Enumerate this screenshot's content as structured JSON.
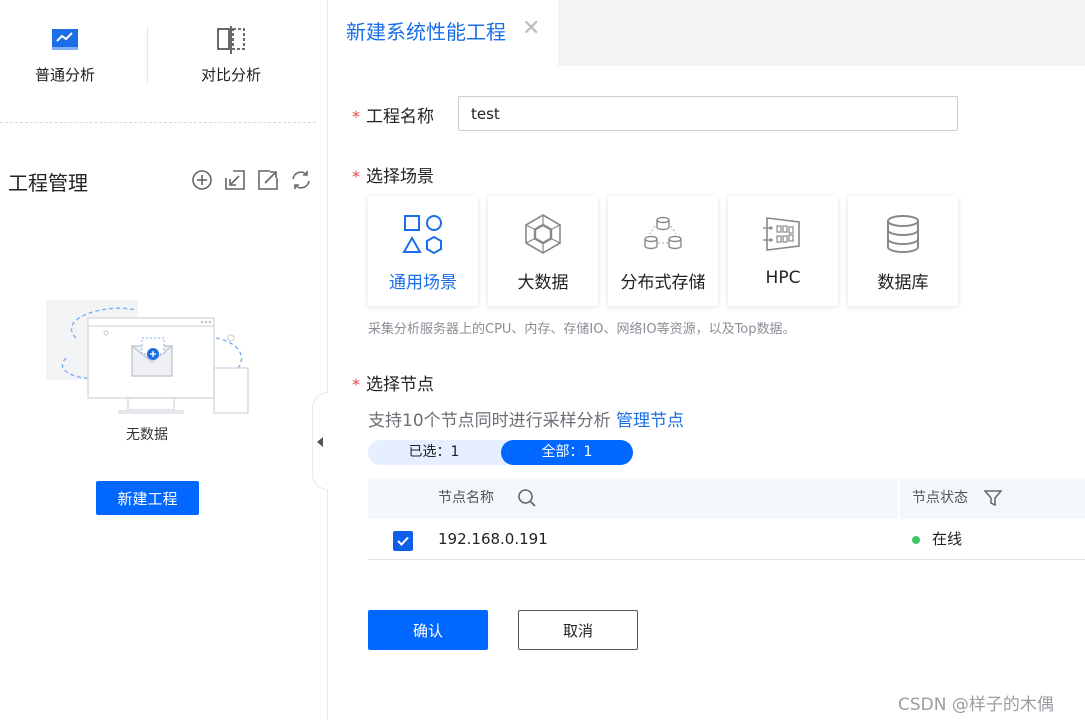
{
  "colors": {
    "accent": "#0067ff",
    "link": "#1a6fe8",
    "online": "#3fc564",
    "required": "#e5483e"
  },
  "sidebar": {
    "modes": [
      {
        "label": "普通分析",
        "icon": "monitor-chart-icon",
        "active": true
      },
      {
        "label": "对比分析",
        "icon": "compare-split-icon",
        "active": false
      }
    ],
    "project_title": "工程管理",
    "tools": [
      "add-circle-icon",
      "import-icon",
      "export-icon",
      "refresh-icon"
    ],
    "empty_text": "无数据",
    "new_project_label": "新建工程"
  },
  "tab": {
    "title": "新建系统性能工程",
    "close_glyph": "✕"
  },
  "form": {
    "required_mark": "*",
    "name_label": "工程名称",
    "name_value": "test",
    "scene_label": "选择场景",
    "scenes": [
      {
        "label": "通用场景",
        "icon": "shapes-icon",
        "active": true
      },
      {
        "label": "大数据",
        "icon": "hexagon-network-icon",
        "active": false
      },
      {
        "label": "分布式存储",
        "icon": "distributed-storage-icon",
        "active": false
      },
      {
        "label": "HPC",
        "icon": "server-board-icon",
        "active": false
      },
      {
        "label": "数据库",
        "icon": "database-icon",
        "active": false
      }
    ],
    "scene_desc": "采集分析服务器上的CPU、内存、存储IO、网络IO等资源，以及Top数据。",
    "node_label": "选择节点",
    "node_hint": "支持10个节点同时进行采样分析",
    "manage_link": "管理节点",
    "seg_selected": "已选：1",
    "seg_all": "全部：1",
    "table": {
      "col_name": "节点名称",
      "col_status": "节点状态",
      "rows": [
        {
          "ip": "192.168.0.191",
          "status": "在线",
          "checked": true
        }
      ]
    },
    "confirm_label": "确认",
    "cancel_label": "取消"
  },
  "watermark": "CSDN @样子的木偶"
}
